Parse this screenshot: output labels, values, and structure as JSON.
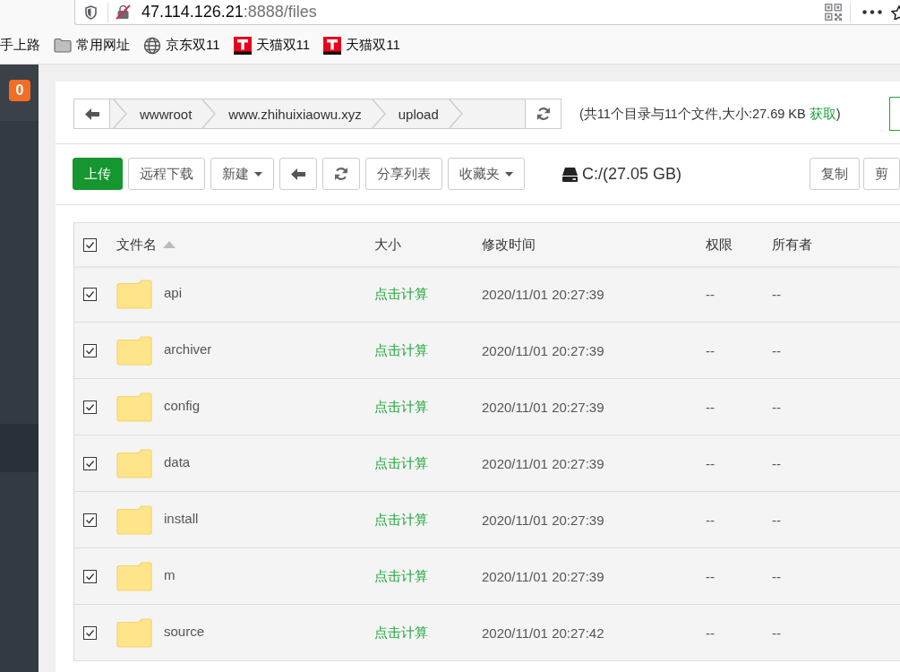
{
  "browser": {
    "url_host": "47.114.126.21",
    "url_path": ":8888/files",
    "bookmarks": [
      {
        "kind": "plain",
        "label": "手上路"
      },
      {
        "kind": "folder",
        "label": "常用网址"
      },
      {
        "kind": "globe",
        "label": "京东双11"
      },
      {
        "kind": "tmall",
        "label": "天猫双11"
      },
      {
        "kind": "tmall",
        "label": "天猫双11"
      }
    ]
  },
  "sidebar": {
    "badge": "0"
  },
  "path_bar": {
    "crumbs": [
      "wwwroot",
      "www.zhihuixiaowu.xyz",
      "upload"
    ],
    "summary": "(共11个目录与11个文件,大小:27.69 KB",
    "summary_link": "获取",
    "summary_end": ")"
  },
  "toolbar": {
    "buttons": [
      {
        "kind": "primary",
        "label": "上传"
      },
      {
        "kind": "plain",
        "label": "远程下载"
      },
      {
        "kind": "dropdown",
        "label": "新建"
      },
      {
        "kind": "back"
      },
      {
        "kind": "refresh"
      },
      {
        "kind": "plain",
        "label": "分享列表"
      },
      {
        "kind": "dropdown",
        "label": "收藏夹"
      }
    ],
    "disk": "C:/(27.05 GB)",
    "actions": [
      "复制",
      "剪"
    ]
  },
  "table": {
    "all_checked": true,
    "columns": [
      {
        "label": "文件名",
        "sorted": true
      },
      {
        "label": "大小",
        "sorted": false
      },
      {
        "label": "修改时间",
        "sorted": false
      },
      {
        "label": "权限",
        "sorted": false
      },
      {
        "label": "所有者",
        "sorted": false
      }
    ],
    "rows": [
      {
        "name": "api",
        "size": "点击计算",
        "modified": "2020/11/01 20:27:39",
        "permission": "--",
        "owner": "--",
        "checked": true
      },
      {
        "name": "archiver",
        "size": "点击计算",
        "modified": "2020/11/01 20:27:39",
        "permission": "--",
        "owner": "--",
        "checked": true
      },
      {
        "name": "config",
        "size": "点击计算",
        "modified": "2020/11/01 20:27:39",
        "permission": "--",
        "owner": "--",
        "checked": true
      },
      {
        "name": "data",
        "size": "点击计算",
        "modified": "2020/11/01 20:27:39",
        "permission": "--",
        "owner": "--",
        "checked": true
      },
      {
        "name": "install",
        "size": "点击计算",
        "modified": "2020/11/01 20:27:39",
        "permission": "--",
        "owner": "--",
        "checked": true
      },
      {
        "name": "m",
        "size": "点击计算",
        "modified": "2020/11/01 20:27:39",
        "permission": "--",
        "owner": "--",
        "checked": true
      },
      {
        "name": "source",
        "size": "点击计算",
        "modified": "2020/11/01 20:27:42",
        "permission": "--",
        "owner": "--",
        "checked": true
      }
    ]
  }
}
